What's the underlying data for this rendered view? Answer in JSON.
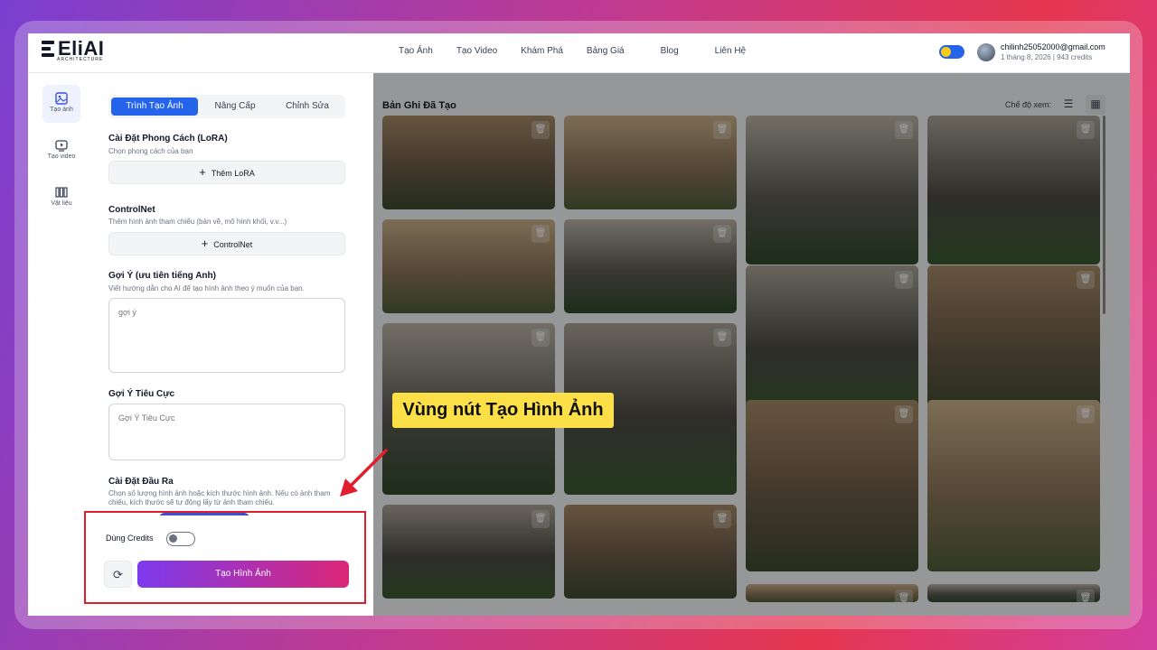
{
  "logo": {
    "name": "EliAI",
    "sub": "ARCHITECTURE"
  },
  "nav": {
    "items": [
      "Tạo Ảnh",
      "Tạo Video",
      "Khám Phá",
      "Bảng Giá",
      "Blog",
      "Liên Hệ"
    ]
  },
  "user": {
    "email": "chilinh25052000@gmail.com",
    "info": "1 tháng 8, 2026 | 943 credits"
  },
  "sidebar": {
    "items": [
      {
        "label": "Tạo ảnh",
        "icon": "image-icon"
      },
      {
        "label": "Tạo video",
        "icon": "video-icon"
      },
      {
        "label": "Vật liệu",
        "icon": "material-icon"
      }
    ]
  },
  "tabs": [
    "Trình Tạo Ảnh",
    "Nâng Cấp",
    "Chỉnh Sửa"
  ],
  "lora": {
    "label": "Cài Đặt Phong Cách (LoRA)",
    "help": "Chọn phong cách của bạn",
    "button": "Thêm LoRA"
  },
  "controlnet": {
    "label": "ControlNet",
    "help": "Thêm hình ảnh tham chiếu (bản vẽ, mô hình khối, v.v...)",
    "button": "ControlNet"
  },
  "prompt": {
    "label": "Gợi Ý (ưu tiên tiếng Anh)",
    "help": "Viết hướng dẫn cho AI để tạo hình ảnh theo ý muốn của bạn.",
    "placeholder": "gợi ý"
  },
  "negative": {
    "label": "Gợi Ý Tiêu Cực",
    "placeholder": "Gợi Ý Tiêu Cực"
  },
  "output": {
    "label": "Cài Đặt Đầu Ra",
    "help": "Chọn số lượng hình ảnh hoặc kích thước hình ảnh. Nếu có ảnh tham chiếu, kích thước sẽ tự động lấy từ ảnh tham chiếu."
  },
  "credits": {
    "label": "Dùng Credits"
  },
  "generate": {
    "label": "Tạo Hình Ảnh"
  },
  "callout": {
    "text": "Vùng nút Tạo Hình Ảnh"
  },
  "gallery": {
    "title": "Bản Ghi Đã Tạo",
    "view_label": "Chế độ xem:"
  },
  "colors": {
    "accent": "#2563eb",
    "generate_start": "#7c3aed",
    "generate_end": "#db2777",
    "highlight": "#e11d2e",
    "callout_bg": "#fde047"
  }
}
